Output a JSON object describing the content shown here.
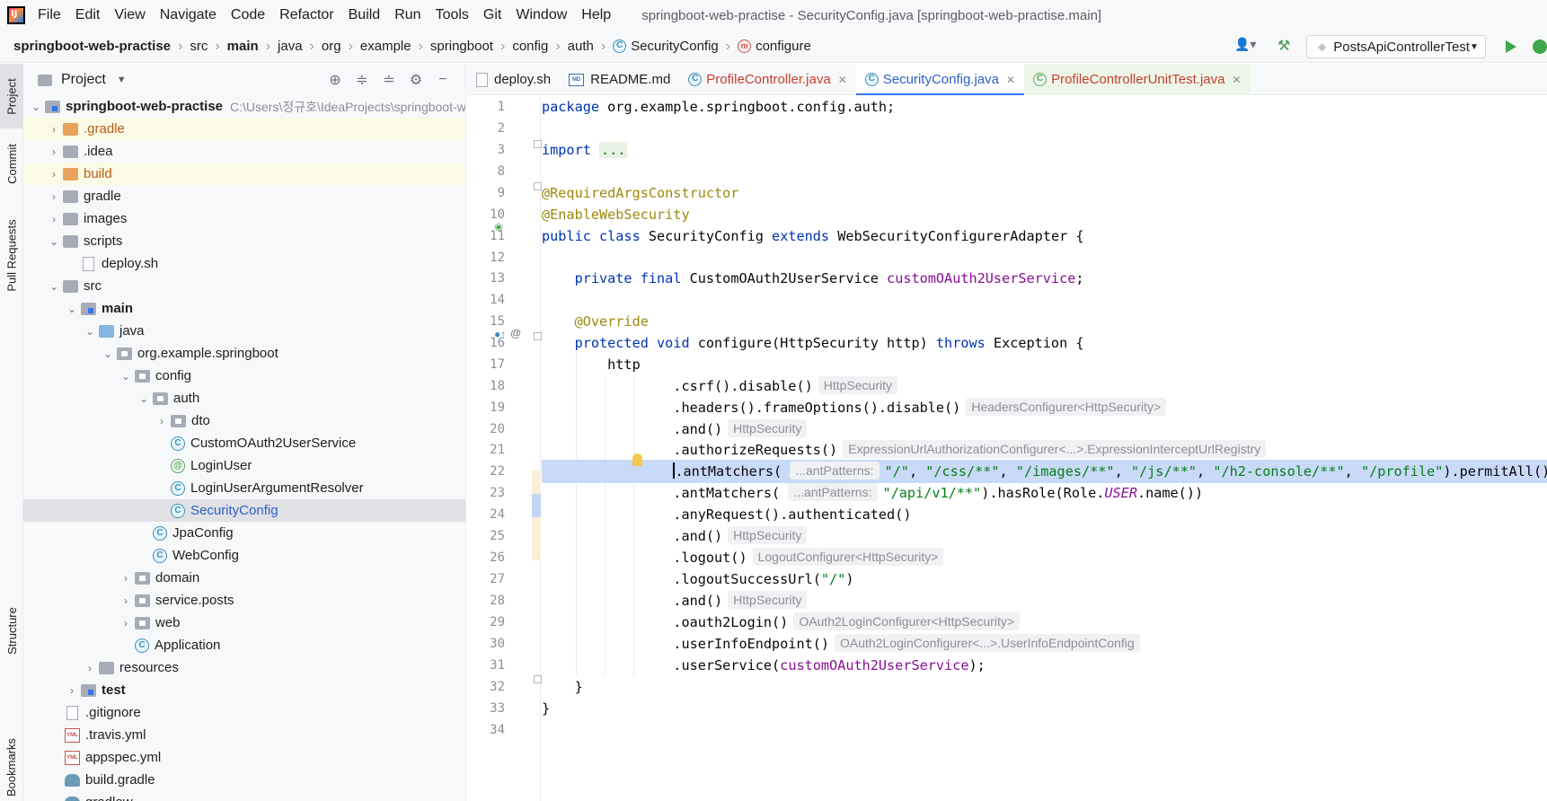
{
  "menubar": {
    "items": [
      "File",
      "Edit",
      "View",
      "Navigate",
      "Code",
      "Refactor",
      "Build",
      "Run",
      "Tools",
      "Git",
      "Window",
      "Help"
    ],
    "window_title": "springboot-web-practise - SecurityConfig.java [springboot-web-practise.main]"
  },
  "navbar": {
    "crumbs": [
      "springboot-web-practise",
      "src",
      "main",
      "java",
      "org",
      "example",
      "springboot",
      "config",
      "auth",
      "SecurityConfig",
      "configure"
    ],
    "run_config": "PostsApiControllerTest"
  },
  "left_strip": {
    "project": "Project",
    "commit": "Commit",
    "pull_requests": "Pull Requests",
    "structure": "Structure",
    "bookmarks": "Bookmarks"
  },
  "project_panel": {
    "title": "Project",
    "root_name": "springboot-web-practise",
    "root_path": "C:\\Users\\정규호\\IdeaProjects\\springboot-web-practise",
    "tree": [
      {
        "label": ".gradle"
      },
      {
        "label": ".idea"
      },
      {
        "label": "build"
      },
      {
        "label": "gradle"
      },
      {
        "label": "images"
      },
      {
        "label": "scripts"
      },
      {
        "label": "deploy.sh"
      },
      {
        "label": "src"
      },
      {
        "label": "main"
      },
      {
        "label": "java"
      },
      {
        "label": "org.example.springboot"
      },
      {
        "label": "config"
      },
      {
        "label": "auth"
      },
      {
        "label": "dto"
      },
      {
        "label": "CustomOAuth2UserService"
      },
      {
        "label": "LoginUser"
      },
      {
        "label": "LoginUserArgumentResolver"
      },
      {
        "label": "SecurityConfig"
      },
      {
        "label": "JpaConfig"
      },
      {
        "label": "WebConfig"
      },
      {
        "label": "domain"
      },
      {
        "label": "service.posts"
      },
      {
        "label": "web"
      },
      {
        "label": "Application"
      },
      {
        "label": "resources"
      },
      {
        "label": "test"
      },
      {
        "label": ".gitignore"
      },
      {
        "label": ".travis.yml"
      },
      {
        "label": "appspec.yml"
      },
      {
        "label": "build.gradle"
      },
      {
        "label": "gradlew"
      }
    ]
  },
  "tabs": [
    "deploy.sh",
    "README.md",
    "ProfileController.java",
    "SecurityConfig.java",
    "ProfileControllerUnitTest.java"
  ],
  "editor": {
    "line_numbers": [
      "1",
      "2",
      "3",
      "8",
      "9",
      "10",
      "11",
      "12",
      "13",
      "14",
      "15",
      "16",
      "17",
      "18",
      "19",
      "20",
      "21",
      "22",
      "23",
      "24",
      "25",
      "26",
      "27",
      "28",
      "29",
      "30",
      "31",
      "32",
      "33",
      "34"
    ],
    "code": {
      "l1a": "package",
      "l1b": " org.example.springboot.config.auth;",
      "l3a": "import",
      "l3b": "...",
      "l9": "@RequiredArgsConstructor",
      "l10": "@EnableWebSecurity",
      "l11a": "public class",
      "l11b": " SecurityConfig ",
      "l11c": "extends",
      "l11d": " WebSecurityConfigurerAdapter {",
      "l13a": "    private final",
      "l13b": " CustomOAuth2UserService ",
      "l13c": "customOAuth2UserService",
      "l13d": ";",
      "l15": "    @Override",
      "l16a": "    protected void",
      "l16b": " configure(HttpSecurity http) ",
      "l16c": "throws",
      "l16d": " Exception {",
      "l17": "        http",
      "l18": "                .csrf().disable()",
      "l18h": "HttpSecurity",
      "l19": "                .headers().frameOptions().disable()",
      "l19h": "HeadersConfigurer<HttpSecurity>",
      "l20": "                .and()",
      "l20h": "HttpSecurity",
      "l21": "                .authorizeRequests()",
      "l21h": "ExpressionUrlAuthorizationConfigurer<...>.ExpressionInterceptUrlRegistry",
      "l22a": "                ",
      "l22b": ".antMatchers(",
      "l22h": "...antPatterns:",
      "l22c": "\"/\"",
      "l22d": ", ",
      "l22e": "\"/css/**\"",
      "l22f": ", ",
      "l22g": "\"/images/**\"",
      "l22i": ", ",
      "l22j": "\"/js/**\"",
      "l22k": ", ",
      "l22l": "\"/h2-console/**\"",
      "l22m": ", ",
      "l22n": "\"/profile\"",
      "l22o": ").permitAll()",
      "l23a": "                .antMatchers(",
      "l23h": "...antPatterns:",
      "l23b": "\"/api/v1/**\"",
      "l23c": ").hasRole(Role.",
      "l23d": "USER",
      "l23e": ".name())",
      "l24": "                .anyRequest().authenticated()",
      "l25": "                .and()",
      "l25h": "HttpSecurity",
      "l26": "                .logout()",
      "l26h": "LogoutConfigurer<HttpSecurity>",
      "l27a": "                .logoutSuccessUrl(",
      "l27b": "\"/\"",
      "l27c": ")",
      "l28": "                .and()",
      "l28h": "HttpSecurity",
      "l29": "                .oauth2Login()",
      "l29h": "OAuth2LoginConfigurer<HttpSecurity>",
      "l30": "                .userInfoEndpoint()",
      "l30h": "OAuth2LoginConfigurer<...>.UserInfoEndpointConfig",
      "l31a": "                .userService(",
      "l31b": "customOAuth2UserService",
      "l31c": ");",
      "l32": "    }",
      "l33": "}"
    }
  }
}
